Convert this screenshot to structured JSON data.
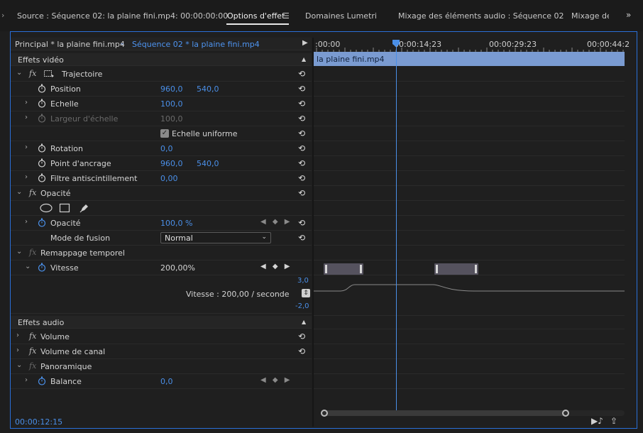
{
  "tabs": {
    "source": "Source : Séquence 02: la plaine fini.mp4: 00:00:00:00",
    "effect_controls": "Options d'effet",
    "effect_controls_menu": "☰",
    "lumetri": "Domaines Lumetri",
    "audio_mixer": "Mixage des éléments audio : Séquence 02",
    "audio_mixer2": "Mixage des",
    "overflow": "»",
    "left_overflow": "›"
  },
  "clipbar": {
    "master": "Principal * la plaine fini.mp4",
    "chevron": "⌄",
    "sequence": "Séquence 02 * la plaine fini.mp4",
    "play": "▶"
  },
  "timeline": {
    "timecodes": [
      ":00:00",
      "00:00:14:23",
      "00:00:29:23",
      "00:00:44:2"
    ],
    "clip_name": "la plaine fini.mp4"
  },
  "video_effects": {
    "header": "Effets vidéo",
    "motion": {
      "label": "Trajectoire",
      "position": {
        "label": "Position",
        "x": "960,0",
        "y": "540,0"
      },
      "scale": {
        "label": "Echelle",
        "value": "100,0"
      },
      "scale_width": {
        "label": "Largeur d'échelle",
        "value": "100,0"
      },
      "uniform_scale": {
        "label": "Echelle uniforme",
        "checked": true
      },
      "rotation": {
        "label": "Rotation",
        "value": "0,0"
      },
      "anchor": {
        "label": "Point d'ancrage",
        "x": "960,0",
        "y": "540,0"
      },
      "anti_flicker": {
        "label": "Filtre antiscintillement",
        "value": "0,00"
      }
    },
    "opacity": {
      "label": "Opacité",
      "value_label": "Opacité",
      "value": "100,0 %",
      "blend_label": "Mode de fusion",
      "blend_value": "Normal"
    },
    "time_remap": {
      "label": "Remappage temporel",
      "speed_label": "Vitesse",
      "speed_value": "200,00%",
      "graph_max": "3,0",
      "graph_min": "-2,0",
      "graph_caption": "Vitesse : 200,00 / seconde"
    }
  },
  "audio_effects": {
    "header": "Effets audio",
    "volume": "Volume",
    "channel_volume": "Volume de canal",
    "panner": "Panoramique",
    "balance": {
      "label": "Balance",
      "value": "0,0"
    }
  },
  "footer": {
    "timecode": "00:00:12:15"
  },
  "symbols": {
    "reset": "⟲",
    "expand_right": "›",
    "expand_down": "⌄",
    "fx": "fx",
    "kf_nav": "◀ ◆ ▶",
    "check": "✓",
    "section_collapse": "▲",
    "select_chevron": "⌄",
    "graph_btn": "⇕",
    "play_to_out": "▶♪",
    "export": "⇪"
  },
  "colors": {
    "accent_blue": "#4a8fe8",
    "clip_blue": "#7a9bd1",
    "panel_border": "#2a6fd8"
  }
}
